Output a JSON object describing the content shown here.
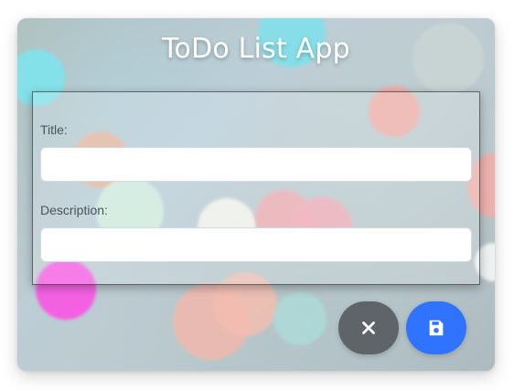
{
  "app": {
    "title": "ToDo List App"
  },
  "form": {
    "title_label": "Title:",
    "title_value": "",
    "title_placeholder": "",
    "description_label": "Description:",
    "description_value": "",
    "description_placeholder": ""
  },
  "actions": {
    "cancel_icon": "close-icon",
    "save_icon": "save-icon",
    "cancel_color": "#5f6469",
    "save_color": "#2f73ff"
  }
}
